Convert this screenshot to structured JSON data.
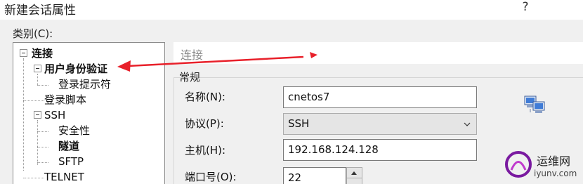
{
  "window": {
    "title": "新建会话属性",
    "help": "?"
  },
  "category_label": "类别(C):",
  "tree": {
    "items": [
      {
        "label": "连接",
        "bold": true
      },
      {
        "label": "用户身份验证",
        "bold": true
      },
      {
        "label": "登录提示符",
        "bold": false
      },
      {
        "label": "登录脚本",
        "bold": false
      },
      {
        "label": "SSH",
        "bold": false
      },
      {
        "label": "安全性",
        "bold": false
      },
      {
        "label": "隧道",
        "bold": true
      },
      {
        "label": "SFTP",
        "bold": false
      },
      {
        "label": "TELNET",
        "bold": false
      }
    ]
  },
  "panel": {
    "header": "连接",
    "group_title": "常规",
    "fields": {
      "name_label": "名称(N):",
      "name_value": "cnetos7",
      "protocol_label": "协议(P):",
      "protocol_value": "SSH",
      "host_label": "主机(H):",
      "host_value": "192.168.124.128",
      "port_label": "端口号(O):",
      "port_value": "22"
    }
  },
  "watermark": {
    "title": "运维网",
    "domain": "iyunv.com"
  },
  "colors": {
    "annotation_arrow": "#e8202a",
    "window_bg": "#f0f0f0",
    "field_border": "#7a7a7a"
  }
}
